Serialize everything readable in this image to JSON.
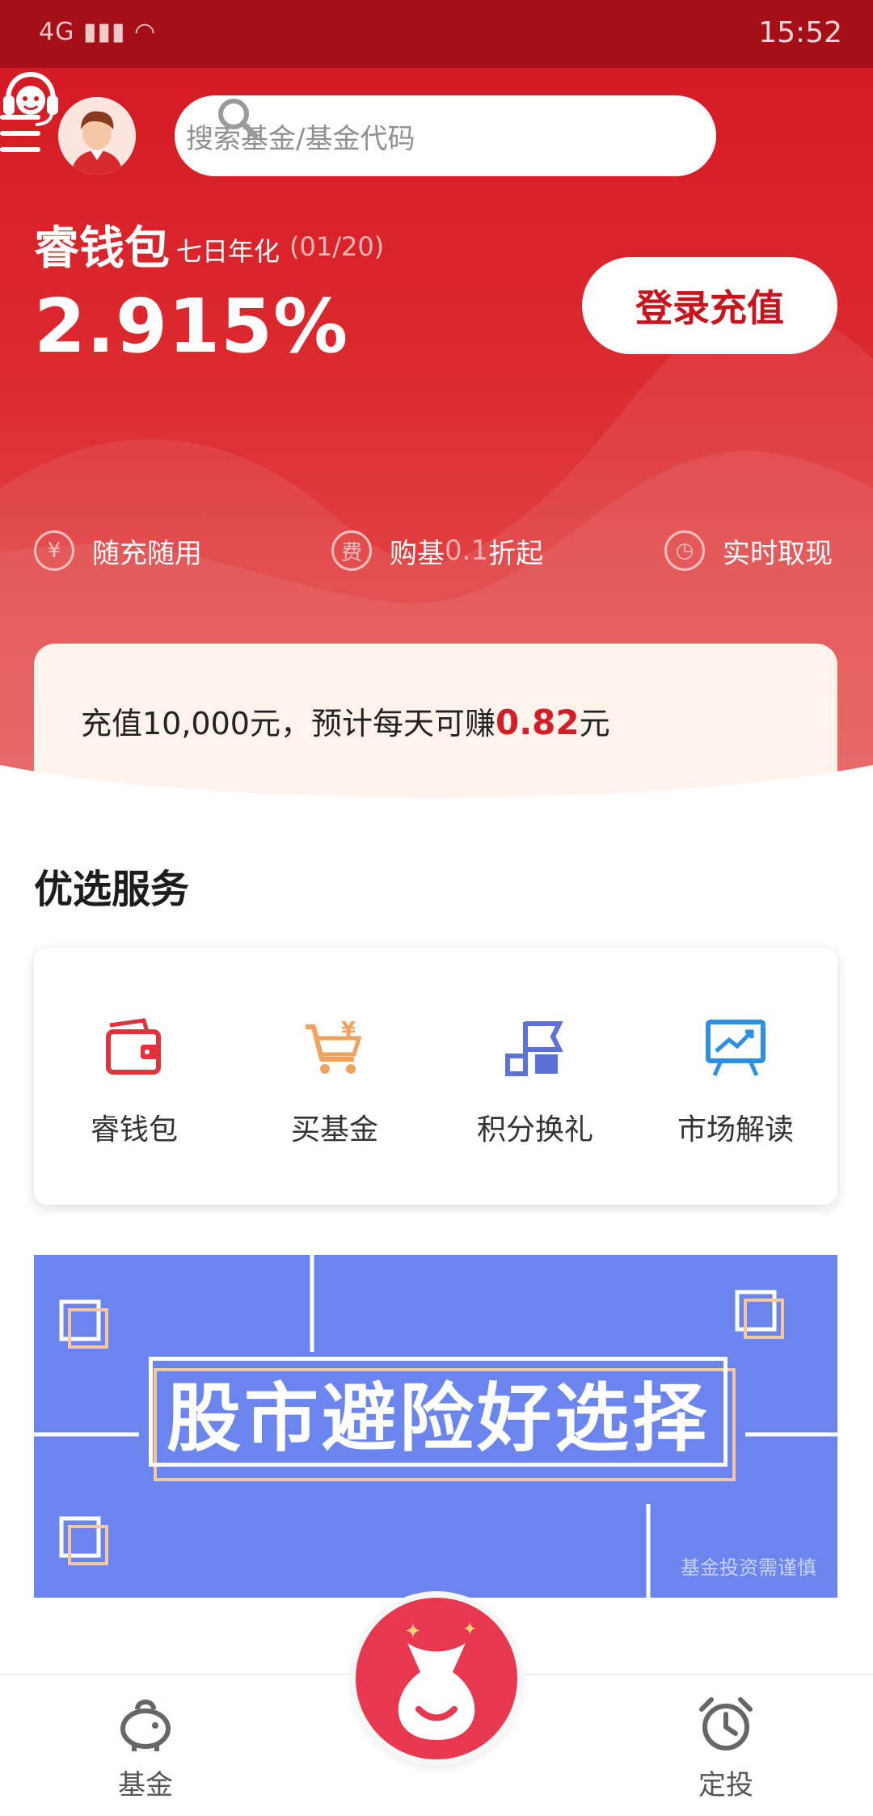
{
  "status_bar": {
    "network": "4G",
    "time": "15:52"
  },
  "header": {
    "search_placeholder": "搜索基金/基金代码"
  },
  "product": {
    "name": "睿钱包",
    "label": "七日年化",
    "date": "(01/20)",
    "rate": "2.915%",
    "login_button": "登录充值"
  },
  "features": [
    {
      "icon_glyph": "¥",
      "icon": "yen-circle-icon",
      "text": "随充随用"
    },
    {
      "icon_glyph": "费",
      "icon": "fee-circle-icon",
      "text_pre": "购基",
      "text_dim": "0.1",
      "text_post": "折起"
    },
    {
      "icon_glyph": "◷",
      "icon": "clock-icon",
      "text": "实时取现"
    }
  ],
  "promo": {
    "prefix": "充值10,000元，预计每天可赚",
    "amount": "0.82",
    "suffix": "元"
  },
  "section": {
    "title": "优选服务"
  },
  "services": [
    {
      "label": "睿钱包",
      "icon": "wallet-icon",
      "color": "#e2323c"
    },
    {
      "label": "买基金",
      "icon": "cart-icon",
      "color": "#f2a15a"
    },
    {
      "label": "积分换礼",
      "icon": "flag-icon",
      "color": "#5d72d8"
    },
    {
      "label": "市场解读",
      "icon": "presentation-icon",
      "color": "#2f8fe0"
    }
  ],
  "banner": {
    "title": "股市避险好选择",
    "note": "基金投资需谨慎",
    "color": "#6b84ee"
  },
  "tabs": [
    {
      "label": "基金",
      "icon": "piggy-bank-icon"
    },
    {
      "label": "定投",
      "icon": "alarm-clock-icon"
    }
  ],
  "colors": {
    "brand_red": "#d51b25",
    "accent_red": "#d41d25"
  }
}
